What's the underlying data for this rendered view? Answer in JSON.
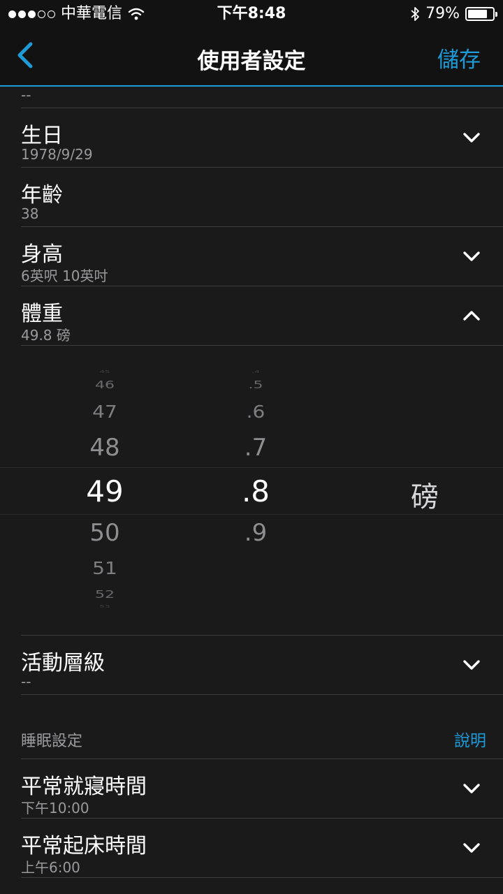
{
  "status_bar": {
    "carrier": "中華電信",
    "time": "下午8:48",
    "battery_percent": "79%",
    "battery_level": 0.79
  },
  "nav": {
    "title": "使用者設定",
    "save_label": "儲存"
  },
  "top_row": {
    "value": "--"
  },
  "rows": [
    {
      "label": "生日",
      "value": "1978/9/29"
    },
    {
      "label": "年齡",
      "value": "38"
    },
    {
      "label": "身高",
      "value": "6英呎 10英吋"
    },
    {
      "label": "體重",
      "value": "49.8 磅"
    }
  ],
  "picker": {
    "integers": [
      "45",
      "46",
      "47",
      "48",
      "49",
      "50",
      "51",
      "52",
      "53"
    ],
    "decimals": [
      ".4",
      ".5",
      ".6",
      ".7",
      ".8",
      ".9"
    ],
    "unit": "磅",
    "selected_integer": "49",
    "selected_decimal": ".8"
  },
  "activity": {
    "label": "活動層級",
    "value": "--"
  },
  "sleep": {
    "section_title": "睡眠設定",
    "help_label": "說明",
    "rows": [
      {
        "label": "平常就寢時間",
        "value": "下午10:00"
      },
      {
        "label": "平常起床時間",
        "value": "上午6:00"
      }
    ]
  },
  "colors": {
    "accent": "#1d9bd8",
    "background": "#1a1a1b",
    "bar": "#121212"
  },
  "icons": {
    "back": "chevron-left-icon",
    "expand": "chevron-down-icon",
    "collapse": "chevron-up-icon"
  }
}
